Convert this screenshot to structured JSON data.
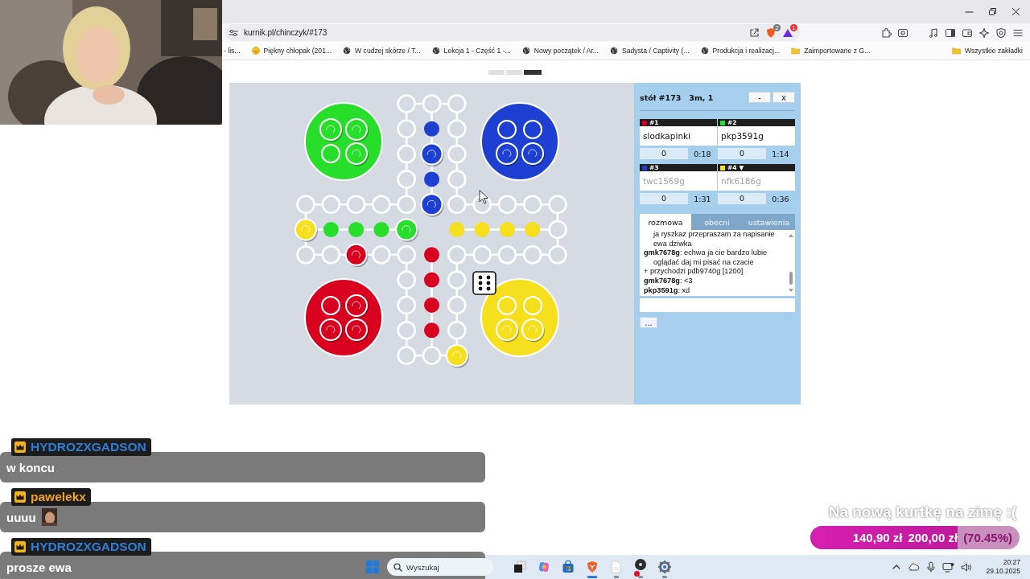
{
  "browser": {
    "url": "kurnik.pl/chinczyk/#173",
    "shield_count": "2",
    "alert_count": "1",
    "bookmarks": [
      {
        "label": "- lis...",
        "kind": "plain"
      },
      {
        "label": "Piękny chłopak (201...",
        "kind": "emoji"
      },
      {
        "label": "W cudzej skórze / T...",
        "kind": "site"
      },
      {
        "label": "Lekcja 1 - Część 1 -...",
        "kind": "site"
      },
      {
        "label": "Nowy początek / Ar...",
        "kind": "site"
      },
      {
        "label": "Sadysta / Captivity (...",
        "kind": "site"
      },
      {
        "label": "Produkcja i realizacj...",
        "kind": "site"
      },
      {
        "label": "Zaimportowane z G...",
        "kind": "folder"
      }
    ],
    "all_bookmarks": "Wszystkie zakładki"
  },
  "view_buttons": [
    {
      "selected": false
    },
    {
      "selected": false
    },
    {
      "selected": true
    }
  ],
  "board": {
    "players": [
      {
        "color": "#27df2a",
        "base": [
          true,
          true,
          false,
          true
        ],
        "home": [
          false,
          false,
          false,
          true
        ]
      },
      {
        "color": "#1d40d2",
        "base": [
          false,
          false,
          true,
          true
        ],
        "home": [
          false,
          true,
          false,
          true
        ]
      },
      {
        "color": "#f6e01e",
        "base": [
          false,
          false,
          true,
          true
        ],
        "home": [
          false,
          false,
          false,
          false
        ]
      },
      {
        "color": "#d8001e",
        "base": [
          false,
          true,
          true,
          true
        ],
        "home": [
          false,
          false,
          false,
          false
        ]
      }
    ],
    "track": [
      {
        "token": false
      },
      {
        "token": false
      },
      {
        "token": false
      },
      {
        "token": false
      },
      {
        "token": false
      },
      {
        "token": false
      },
      {
        "token": false
      },
      {
        "token": false
      },
      {
        "token": false
      },
      {
        "token": false
      },
      {
        "token": false
      },
      {
        "token": false
      },
      {
        "token": false
      },
      {
        "token": false
      },
      {
        "token": false
      },
      {
        "token": false
      },
      {
        "token": false
      },
      {
        "token": false
      },
      {
        "token": false
      },
      {
        "token": false
      },
      {
        "token": false
      },
      {
        "token": false
      },
      {
        "token": false
      },
      {
        "token": false
      },
      {
        "token": false
      },
      {
        "token": false
      },
      {
        "token": false
      },
      {
        "token": false
      },
      {
        "token": true,
        "color": "#f6e01e"
      },
      {
        "token": false
      },
      {
        "token": false
      },
      {
        "token": false
      },
      {
        "token": false
      },
      {
        "token": false
      },
      {
        "token": false
      },
      {
        "token": false
      },
      {
        "token": true,
        "color": "#d8001e"
      },
      {
        "token": false
      },
      {
        "token": false
      },
      {
        "token": true,
        "color": "#f6e01e"
      }
    ]
  },
  "game": {
    "table": "stół #173",
    "mode": "3m, 1",
    "buttons": [
      "-",
      "x"
    ],
    "players": [
      {
        "number": "#1",
        "color": "#d8001e",
        "name": "slodkapinki",
        "active": true,
        "score": "0",
        "time": "0:18"
      },
      {
        "number": "#2",
        "color": "#27df2a",
        "name": "pkp3591g",
        "active": true,
        "score": "0",
        "time": "1:14"
      },
      {
        "number": "#3",
        "color": "#1d40d2",
        "name": "twc1569g",
        "active": false,
        "score": "0",
        "time": "1:31"
      },
      {
        "number": "#4",
        "marker": "▼",
        "color": "#f6e01e",
        "name": "nfk6186g",
        "active": false,
        "score": "0",
        "time": "0:36"
      }
    ],
    "tabs": [
      {
        "label": "rozmowa",
        "selected": true
      },
      {
        "label": "obecni",
        "selected": false
      },
      {
        "label": "ustawienia",
        "selected": false
      }
    ],
    "chat_log": [
      {
        "kind": "continuation",
        "line": "ja ryszkaz przepraszam za napisanie ewa dziwka"
      },
      {
        "kind": "message",
        "line": "**gmk7678g**: echwa ja cie bardzo lubie oglądać daj mi pisać na czacie"
      },
      {
        "kind": "system",
        "line": "+ przychodzi pdb9740g [1200]"
      },
      {
        "kind": "message",
        "line": "**gmk7678g**: <3"
      },
      {
        "kind": "message",
        "line": "**pkp3591g**: xd"
      }
    ],
    "more_button": "..."
  },
  "stream_chat": [
    {
      "author": "HYDROZXGADSON",
      "color": "#2f7fd9",
      "text": "w koncu",
      "emote": false
    },
    {
      "author": "pawelekx",
      "color": "#f2a41c",
      "text": "uuuu",
      "emote": true
    },
    {
      "author": "HYDROZXGADSON",
      "color": "#2f7fd9",
      "text": "prosze ewa",
      "emote": false
    }
  ],
  "donation_goal": {
    "title": "Na nową kurtkę na zimę :(",
    "raised": "140,90 zł",
    "goal": "200,00 zł",
    "percent": "(70.45%)",
    "level": 0.7045
  },
  "taskbar": {
    "placeholder": "Wyszukaj",
    "apps": [
      {
        "kind": "files",
        "running": false,
        "focused": false
      },
      {
        "kind": "copilot",
        "running": false,
        "focused": false
      },
      {
        "kind": "store",
        "running": false,
        "focused": false
      },
      {
        "kind": "browser",
        "running": true,
        "focused": true
      },
      {
        "kind": "notes",
        "running": true,
        "focused": false
      },
      {
        "kind": "recorder",
        "running": true,
        "focused": false
      },
      {
        "kind": "settings",
        "running": true,
        "focused": false
      }
    ],
    "time": "20:27",
    "date": "29.10.2025"
  }
}
